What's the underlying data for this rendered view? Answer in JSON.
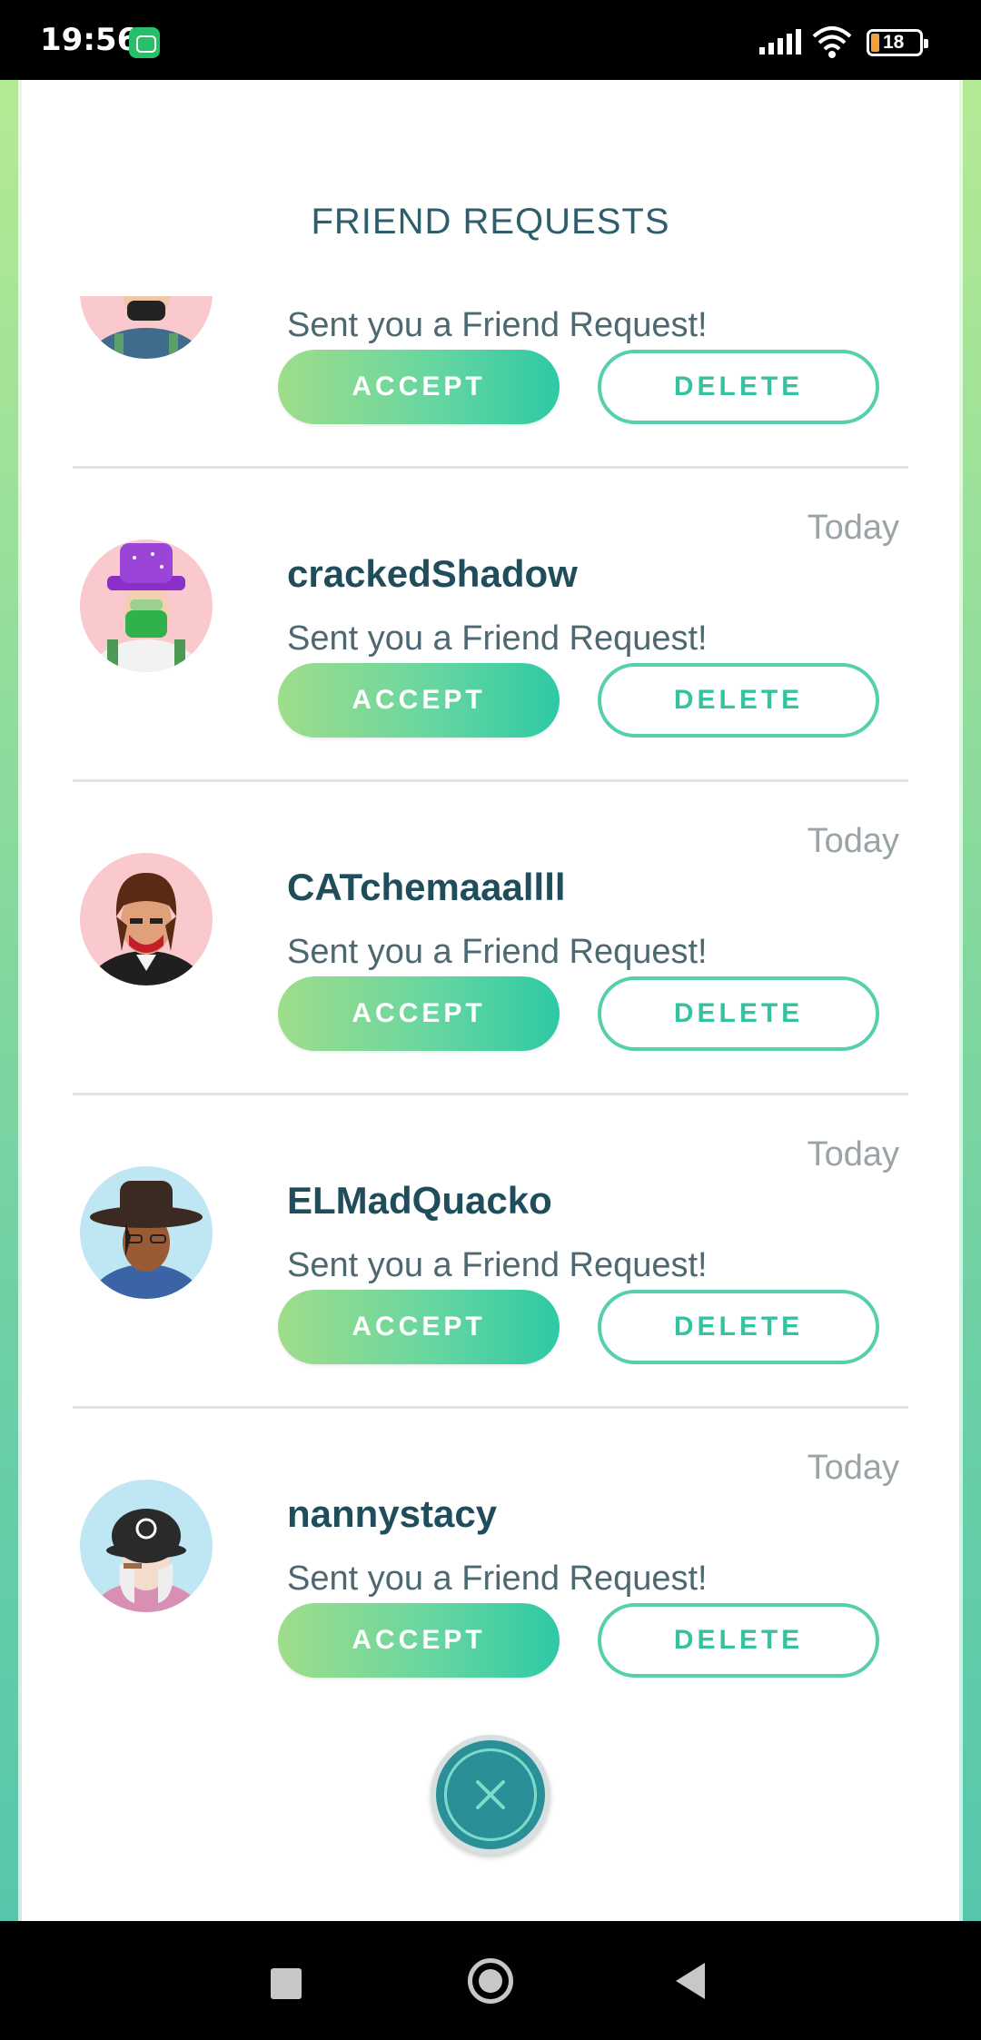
{
  "status_bar": {
    "time": "19:56",
    "battery_level": "18",
    "icons": [
      "app-notification-icon",
      "signal-icon",
      "wifi-icon",
      "battery-icon"
    ]
  },
  "page": {
    "title": "FRIEND REQUESTS"
  },
  "requests": [
    {
      "name": "",
      "time": "",
      "message": "Sent you a Friend Request!",
      "accept_label": "ACCEPT",
      "delete_label": "DELETE"
    },
    {
      "name": "crackedShadow",
      "time": "Today",
      "message": "Sent you a Friend Request!",
      "accept_label": "ACCEPT",
      "delete_label": "DELETE"
    },
    {
      "name": "CATchemaaallll",
      "time": "Today",
      "message": "Sent you a Friend Request!",
      "accept_label": "ACCEPT",
      "delete_label": "DELETE"
    },
    {
      "name": "ELMadQuacko",
      "time": "Today",
      "message": "Sent you a Friend Request!",
      "accept_label": "ACCEPT",
      "delete_label": "DELETE"
    },
    {
      "name": "nannystacy",
      "time": "Today",
      "message": "Sent you a Friend Request!",
      "accept_label": "ACCEPT",
      "delete_label": "DELETE"
    }
  ],
  "colors": {
    "title": "#2c5e6b",
    "name": "#1f4d5c",
    "accept_gradient_start": "#9fdd8a",
    "accept_gradient_end": "#2ec9a6",
    "delete_border": "#55cfae",
    "close_button": "#2b8f97"
  },
  "close": {
    "icon": "close-icon"
  }
}
